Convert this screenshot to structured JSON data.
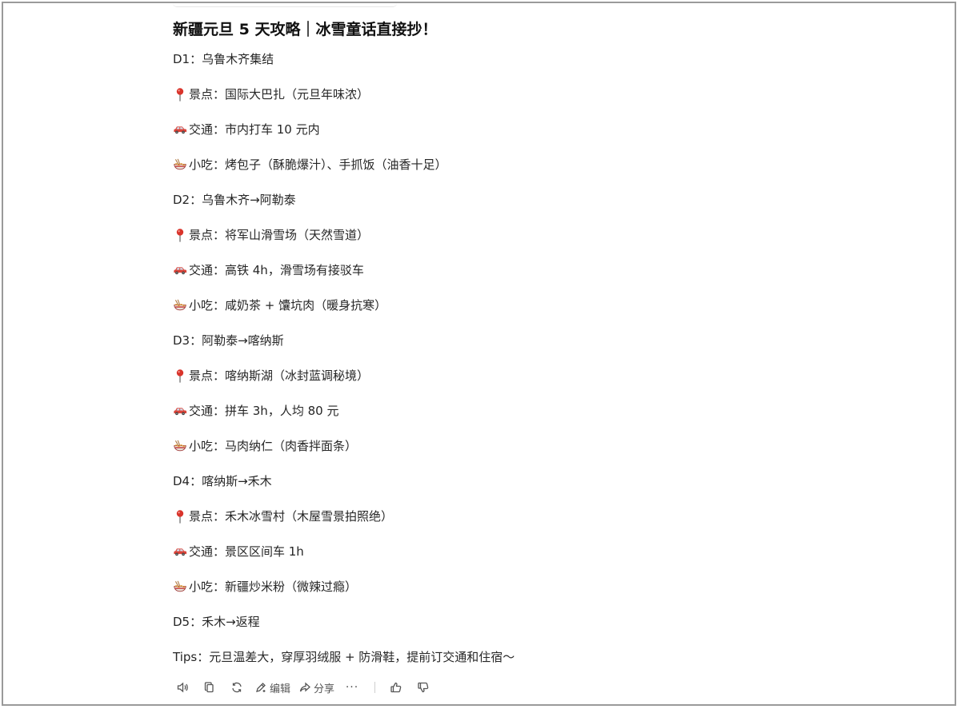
{
  "post": {
    "title": "新疆元旦 5 天攻略｜冰雪童话直接抄！",
    "lines": [
      {
        "icon": "",
        "text": "D1：乌鲁木齐集结"
      },
      {
        "icon": "pin",
        "text": "景点：国际大巴扎（元旦年味浓）"
      },
      {
        "icon": "car",
        "text": "交通：市内打车 10 元内"
      },
      {
        "icon": "noodles",
        "text": "小吃：烤包子（酥脆爆汁）、手抓饭（油香十足）"
      },
      {
        "icon": "",
        "text": "D2：乌鲁木齐→阿勒泰"
      },
      {
        "icon": "pin",
        "text": "景点：将军山滑雪场（天然雪道）"
      },
      {
        "icon": "car",
        "text": "交通：高铁 4h，滑雪场有接驳车"
      },
      {
        "icon": "noodles",
        "text": "小吃：咸奶茶 + 馕坑肉（暖身抗寒）"
      },
      {
        "icon": "",
        "text": "D3：阿勒泰→喀纳斯"
      },
      {
        "icon": "pin",
        "text": "景点：喀纳斯湖（冰封蓝调秘境）"
      },
      {
        "icon": "car",
        "text": "交通：拼车 3h，人均 80 元"
      },
      {
        "icon": "noodles",
        "text": "小吃：马肉纳仁（肉香拌面条）"
      },
      {
        "icon": "",
        "text": "D4：喀纳斯→禾木"
      },
      {
        "icon": "pin",
        "text": "景点：禾木冰雪村（木屋雪景拍照绝）"
      },
      {
        "icon": "car",
        "text": "交通：景区区间车 1h"
      },
      {
        "icon": "noodles",
        "text": "小吃：新疆炒米粉（微辣过瘾）"
      },
      {
        "icon": "",
        "text": "D5：禾木→返程"
      }
    ],
    "tips": "Tips：元旦温差大，穿厚羽绒服 + 防滑鞋，提前订交通和住宿～"
  },
  "actions": {
    "edit_label": "编辑",
    "share_label": "分享",
    "more_label": "···"
  },
  "icons": [
    "speaker-icon",
    "copy-icon",
    "refresh-icon",
    "edit-icon",
    "share-icon",
    "more-icon",
    "thumbs-up-icon",
    "thumbs-down-icon"
  ]
}
